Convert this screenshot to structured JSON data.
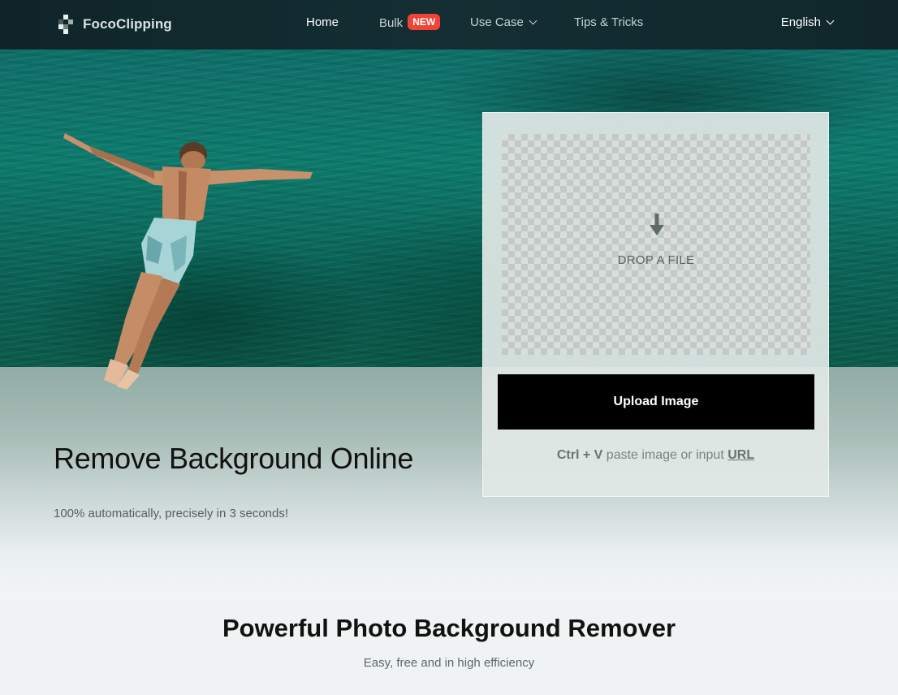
{
  "nav": {
    "logo_text": "FocoClipping",
    "items": [
      {
        "label": "Home",
        "active": true
      },
      {
        "label": "Bulk",
        "badge": "NEW"
      },
      {
        "label": "Use Case",
        "has_dropdown": true
      },
      {
        "label": "Tips & Tricks"
      }
    ],
    "language": "English"
  },
  "hero": {
    "title": "Remove Background Online",
    "subtitle": "100% automatically, precisely in 3 seconds!"
  },
  "upload": {
    "drop_label": "DROP A FILE",
    "button_label": "Upload Image",
    "paste_shortcut": "Ctrl + V",
    "paste_text": " paste image or input ",
    "url_link": "URL"
  },
  "section": {
    "title": "Powerful Photo Background Remover",
    "subtitle": "Easy, free and in high efficiency"
  },
  "colors": {
    "nav_bg": "#142e33",
    "badge_red": "#ef4437",
    "button_black": "#000000"
  }
}
